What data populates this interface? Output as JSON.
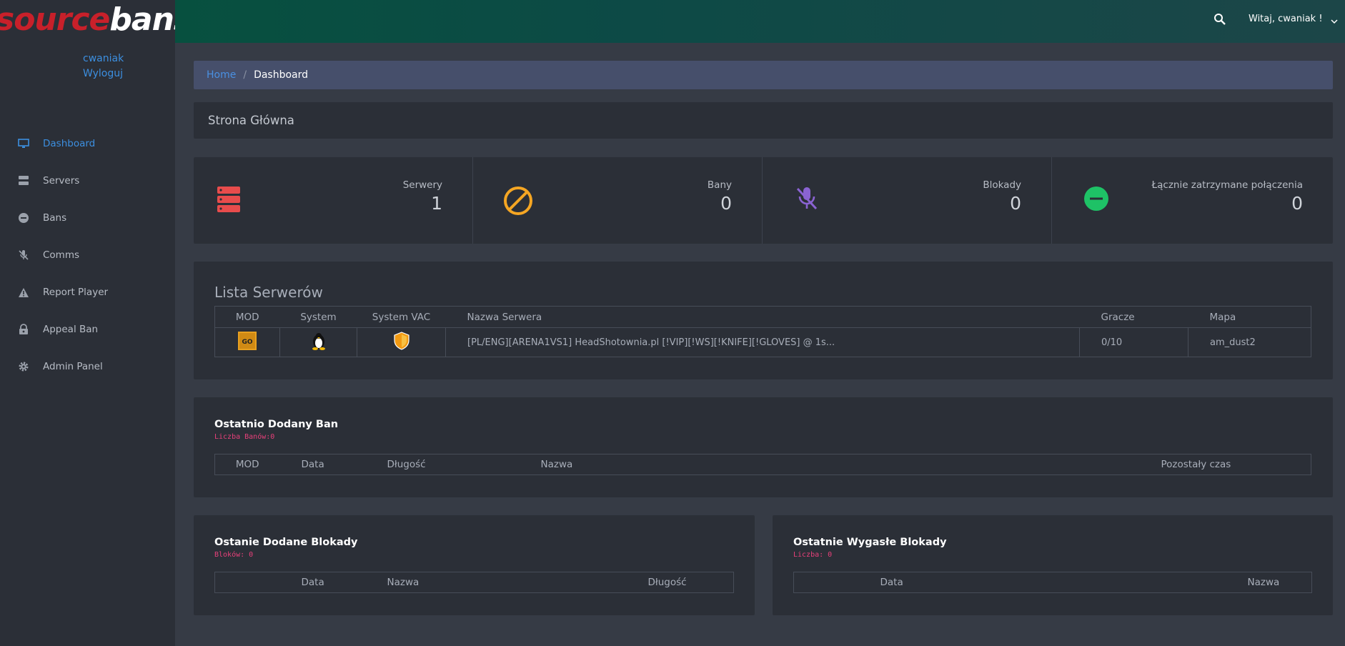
{
  "logo": {
    "part1": "source",
    "part2": "bans"
  },
  "user": {
    "name": "cwaniak",
    "logout": "Wyloguj"
  },
  "nav": [
    {
      "label": "Dashboard",
      "icon": "monitor-icon",
      "active": true
    },
    {
      "label": "Servers",
      "icon": "server-icon",
      "active": false
    },
    {
      "label": "Bans",
      "icon": "ban-icon",
      "active": false
    },
    {
      "label": "Comms",
      "icon": "mic-off-icon",
      "active": false
    },
    {
      "label": "Report Player",
      "icon": "warning-icon",
      "active": false
    },
    {
      "label": "Appeal Ban",
      "icon": "lock-icon",
      "active": false
    },
    {
      "label": "Admin Panel",
      "icon": "gear-icon",
      "active": false
    }
  ],
  "topbar": {
    "greeting": "Witaj, cwaniak !"
  },
  "breadcrumb": {
    "home": "Home",
    "sep": "/",
    "current": "Dashboard"
  },
  "page_title": "Strona Główna",
  "stats": [
    {
      "label": "Serwery",
      "value": "1",
      "icon": "server-stack-icon",
      "color": "#e84c4c"
    },
    {
      "label": "Bany",
      "value": "0",
      "icon": "ban-circle-icon",
      "color": "#f5a623"
    },
    {
      "label": "Blokady",
      "value": "0",
      "icon": "mic-off-icon",
      "color": "#8a63d2"
    },
    {
      "label": "Łącznie zatrzymane połączenia",
      "value": "0",
      "icon": "minus-circle-icon",
      "color": "#1ec266"
    }
  ],
  "servers": {
    "title": "Lista Serwerów",
    "columns": [
      "MOD",
      "System",
      "System VAC",
      "Nazwa Serwera",
      "Gracze",
      "Mapa"
    ],
    "rows": [
      {
        "mod": "csgo-icon",
        "system": "linux-icon",
        "vac": "vac-shield-icon",
        "name": "[PL/ENG][ARENA1VS1] HeadShotownia.pl [!VIP][!WS][!KNIFE][!GLOVES] @ 1s...",
        "players": "0/10",
        "map": "am_dust2"
      }
    ]
  },
  "recent_bans": {
    "title": "Ostatnio Dodany Ban",
    "count_label": "Liczba Banów:0",
    "columns": [
      "MOD",
      "Data",
      "Długość",
      "Nazwa",
      "Pozostały czas"
    ]
  },
  "recent_blocks": {
    "title": "Ostanie Dodane Blokady",
    "count_label": "Bloków: 0",
    "columns": [
      "Data",
      "Nazwa",
      "Długość"
    ]
  },
  "expired_blocks": {
    "title": "Ostatnie Wygasłe Blokady",
    "count_label": "Liczba: 0",
    "columns": [
      "Data",
      "Nazwa"
    ]
  }
}
